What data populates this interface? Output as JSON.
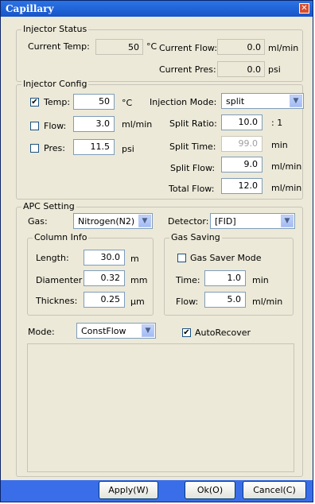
{
  "window": {
    "title": "Capillary",
    "close_glyph": "✕"
  },
  "injector_status": {
    "legend": "Injector Status",
    "current_temp_label": "Current Temp:",
    "current_temp_value": "50",
    "current_temp_unit": "°C",
    "current_flow_label": "Current Flow:",
    "current_flow_value": "0.0",
    "current_flow_unit": "ml/min",
    "current_pres_label": "Current Pres:",
    "current_pres_value": "0.0",
    "current_pres_unit": "psi"
  },
  "injector_config": {
    "legend": "Injector Config",
    "temp": {
      "label": "Temp:",
      "checked": true,
      "value": "50",
      "unit": "°C"
    },
    "flow": {
      "label": "Flow:",
      "checked": false,
      "value": "3.0",
      "unit": "ml/min"
    },
    "pres": {
      "label": "Pres:",
      "checked": false,
      "value": "11.5",
      "unit": "psi"
    },
    "injection_mode_label": "Injection Mode:",
    "injection_mode_value": "split",
    "split_ratio_label": "Split Ratio:",
    "split_ratio_value": "10.0",
    "split_ratio_unit": ": 1",
    "split_time_label": "Split Time:",
    "split_time_value": "99.0",
    "split_time_unit": "min",
    "split_flow_label": "Split Flow:",
    "split_flow_value": "9.0",
    "split_flow_unit": "ml/min",
    "total_flow_label": "Total Flow:",
    "total_flow_value": "12.0",
    "total_flow_unit": "ml/min"
  },
  "apc": {
    "legend": "APC Setting",
    "gas_label": "Gas:",
    "gas_value": "Nitrogen(N2)",
    "detector_label": "Detector:",
    "detector_value": "[FID]",
    "column_info": {
      "legend": "Column Info",
      "length_label": "Length:",
      "length_value": "30.0",
      "length_unit": "m",
      "diameter_label": "Diamenter",
      "diameter_value": "0.32",
      "diameter_unit": "mm",
      "thickness_label": "Thicknes:",
      "thickness_value": "0.25",
      "thickness_unit": "μm"
    },
    "gas_saving": {
      "legend": "Gas Saving",
      "saver_label": "Gas Saver Mode",
      "saver_checked": false,
      "time_label": "Time:",
      "time_value": "1.0",
      "time_unit": "min",
      "flow_label": "Flow:",
      "flow_value": "5.0",
      "flow_unit": "ml/min"
    },
    "mode_label": "Mode:",
    "mode_value": "ConstFlow",
    "autorecover_label": "AutoRecover",
    "autorecover_checked": true
  },
  "buttons": {
    "apply": "Apply(W)",
    "ok": "Ok(O)",
    "cancel": "Cancel(C)"
  },
  "glyphs": {
    "check": "✔",
    "dropdown": "▼"
  },
  "colors": {
    "title_bar": "#2c74e6",
    "dialog_bg": "#ece9d8",
    "button_bar": "#3a6ee8",
    "close_button": "#d64d2f"
  }
}
